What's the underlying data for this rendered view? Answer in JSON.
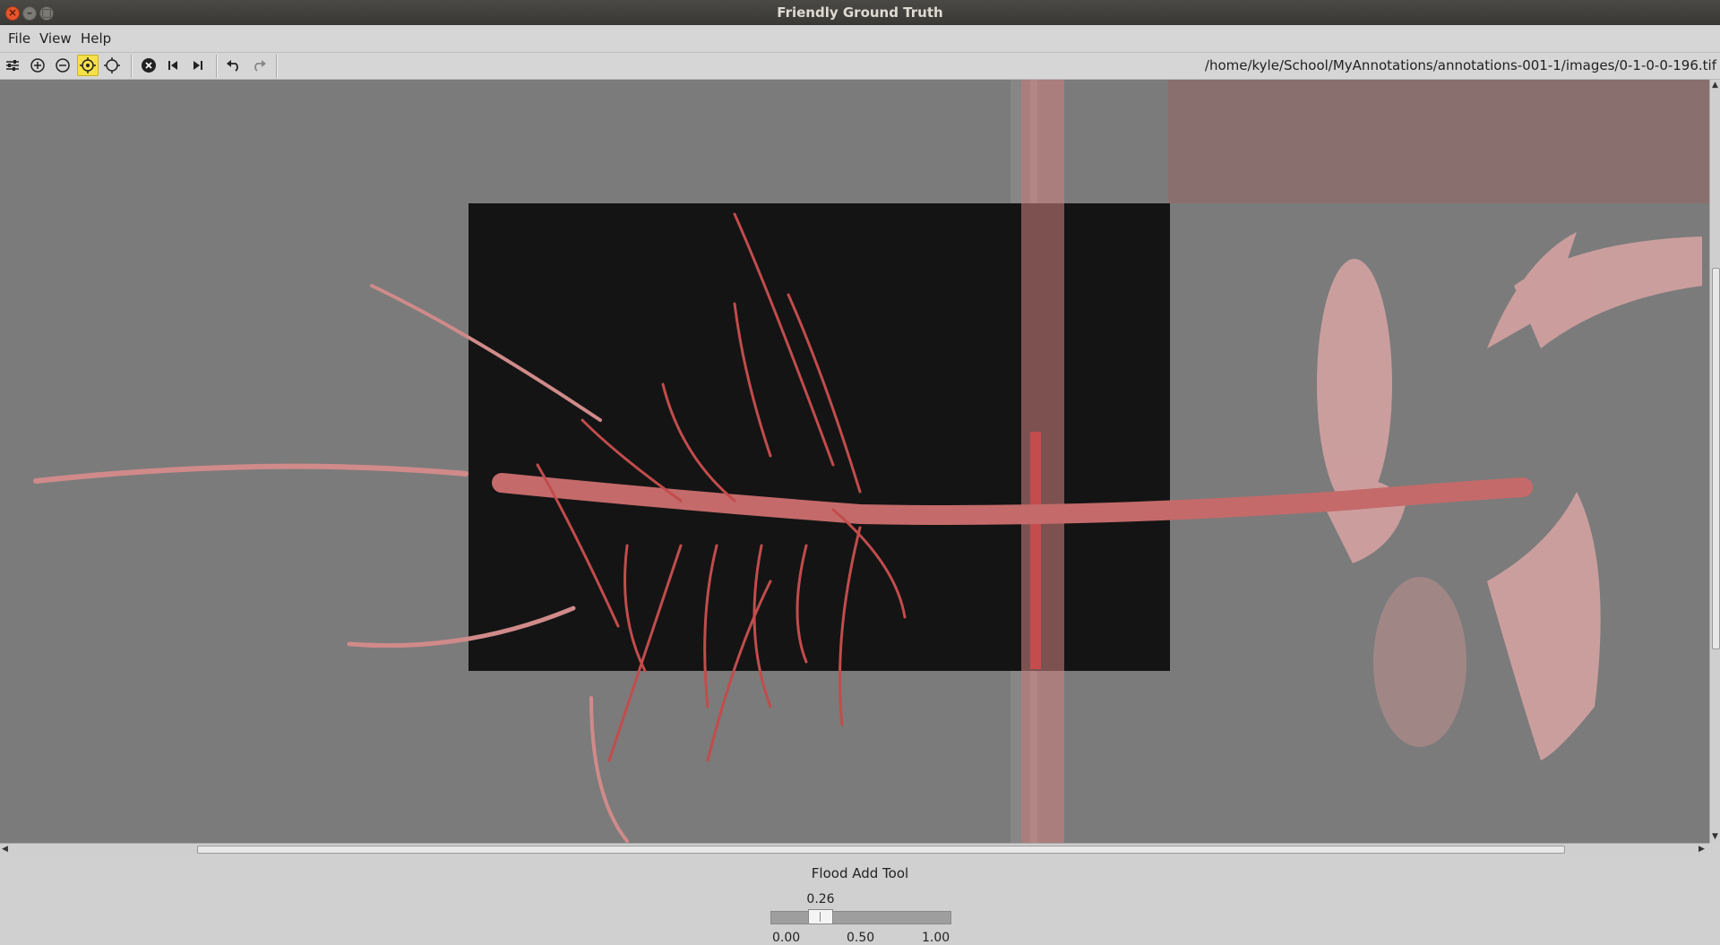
{
  "window": {
    "title": "Friendly Ground Truth"
  },
  "menu": {
    "items": [
      "File",
      "View",
      "Help"
    ]
  },
  "toolbar": {
    "buttons": [
      {
        "name": "adjust-icon"
      },
      {
        "name": "zoom-in-icon"
      },
      {
        "name": "zoom-out-icon"
      },
      {
        "name": "flood-add-icon",
        "active": true
      },
      {
        "name": "flood-remove-icon"
      },
      {
        "name": "close-image-icon"
      },
      {
        "name": "previous-patch-icon"
      },
      {
        "name": "next-patch-icon"
      },
      {
        "name": "undo-icon"
      },
      {
        "name": "redo-icon"
      }
    ],
    "path": "/home/kyle/School/MyAnnotations/annotations-001-1/images/0-1-0-0-196.tif"
  },
  "status": {
    "tool_label": "Flood Add Tool",
    "slider_value": "0.26",
    "slider_fraction": 0.26,
    "ticks": [
      "0.00",
      "0.50",
      "1.00"
    ]
  },
  "colors": {
    "accent_active": "#f5e04a",
    "overlay_red": "#c85a5a"
  }
}
